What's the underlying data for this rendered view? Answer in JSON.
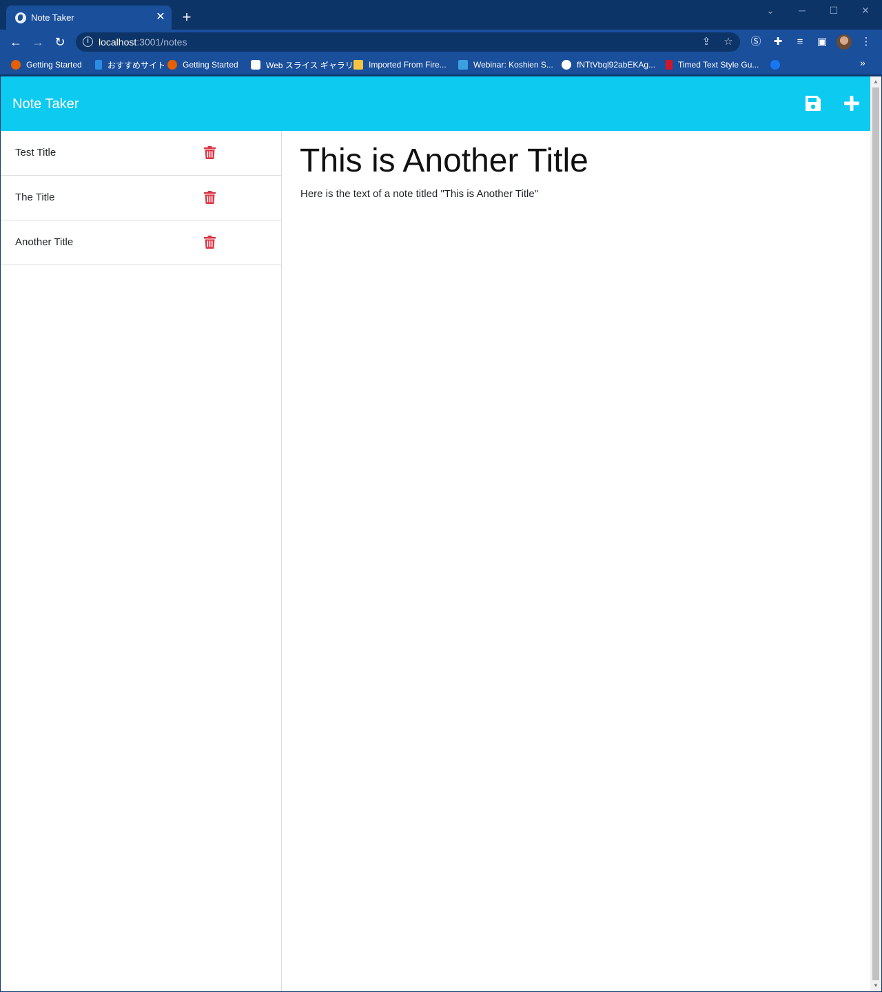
{
  "browser": {
    "tab_title": "Note Taker",
    "tab_close": "✕",
    "new_tab": "+",
    "url_host": "localhost",
    "url_path": ":3001/notes",
    "bookmarks": [
      {
        "label": "Getting Started",
        "icon": "firefox-icon",
        "color": "#e66000"
      },
      {
        "label": "おすすめサイト",
        "icon": "bing-icon",
        "color": "#2b8ce6"
      },
      {
        "label": "Getting Started",
        "icon": "firefox-icon",
        "color": "#e66000"
      },
      {
        "label": "Web スライス ギャラリー",
        "icon": "ie-icon",
        "color": "#ffffff"
      },
      {
        "label": "Imported From Fire...",
        "icon": "folder-icon",
        "color": "#f5c542"
      },
      {
        "label": "Webinar: Koshien S...",
        "icon": "bookmark-icon",
        "color": "#3aa0e0"
      },
      {
        "label": "fNTtVbql92abEKAg...",
        "icon": "globe-icon",
        "color": "#ffffff"
      },
      {
        "label": "Timed Text Style Gu...",
        "icon": "bookmark-icon",
        "color": "#d0162a"
      },
      {
        "label": "",
        "icon": "facebook-icon",
        "color": "#1877f2"
      }
    ],
    "bookmarks_more": "»"
  },
  "app": {
    "brand": "Note Taker",
    "notes": [
      {
        "title": "Test Title"
      },
      {
        "title": "The Title"
      },
      {
        "title": "Another Title"
      }
    ],
    "active_note": {
      "title": "This is Another Title",
      "text": "Here is the text of a note titled \"This is Another Title\""
    },
    "colors": {
      "navbar": "#0dcaf0",
      "delete_icon": "#dc3545"
    }
  }
}
